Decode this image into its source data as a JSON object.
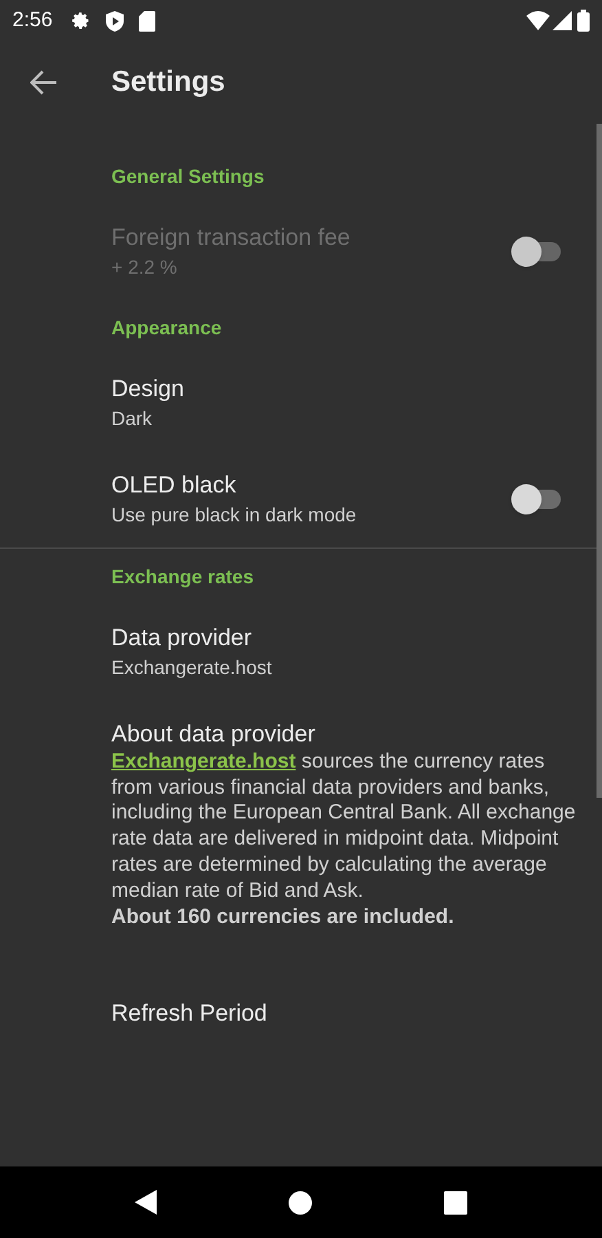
{
  "status_bar": {
    "time": "2:56"
  },
  "toolbar": {
    "title": "Settings"
  },
  "sections": [
    {
      "header": "General Settings",
      "divider": false,
      "items": [
        {
          "kind": "toggle",
          "title": "Foreign transaction fee",
          "subtitle": "+ 2.2 %",
          "disabled": true,
          "on": false
        }
      ]
    },
    {
      "header": "Appearance",
      "divider": true,
      "items": [
        {
          "kind": "value",
          "title": "Design",
          "subtitle": "Dark",
          "disabled": false
        },
        {
          "kind": "toggle",
          "title": "OLED black",
          "subtitle": "Use pure black in dark mode",
          "disabled": false,
          "on": false
        }
      ]
    },
    {
      "header": "Exchange rates",
      "divider": false,
      "items": [
        {
          "kind": "value",
          "title": "Data provider",
          "subtitle": "Exchangerate.host",
          "disabled": false
        },
        {
          "kind": "about",
          "title": "About data provider",
          "link": "Exchangerate.host",
          "text": " sources the currency rates from various financial data providers and banks, including the European Central Bank. All exchange rate data are delivered in midpoint data. Midpoint rates are determined by calculating the average median rate of Bid and Ask.",
          "note": "About 160 currencies are included.",
          "disabled": false
        },
        {
          "kind": "value",
          "title": "Refresh Period",
          "disabled": false
        }
      ]
    }
  ]
}
